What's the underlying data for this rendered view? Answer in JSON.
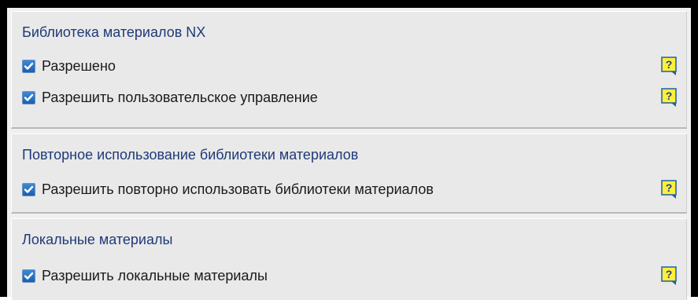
{
  "groups": [
    {
      "title": "Библиотека материалов NX",
      "rows": [
        {
          "label": "Разрешено",
          "checked": true,
          "icon": "help-icon"
        },
        {
          "label": "Разрешить пользовательское управление",
          "checked": true,
          "icon": "help-icon"
        }
      ]
    },
    {
      "title": "Повторное использование библиотеки материалов",
      "rows": [
        {
          "label": "Разрешить повторно использовать библиотеки материалов",
          "checked": true,
          "icon": "help-icon"
        }
      ]
    },
    {
      "title": "Локальные материалы",
      "rows": [
        {
          "label": "Разрешить локальные материалы",
          "checked": true,
          "icon": "help-icon"
        }
      ]
    }
  ],
  "colors": {
    "title_text": "#1e3a78",
    "checkbox_fill": "#2a73c4",
    "help_fill": "#ffef3a",
    "help_border": "#1f5fa8"
  }
}
